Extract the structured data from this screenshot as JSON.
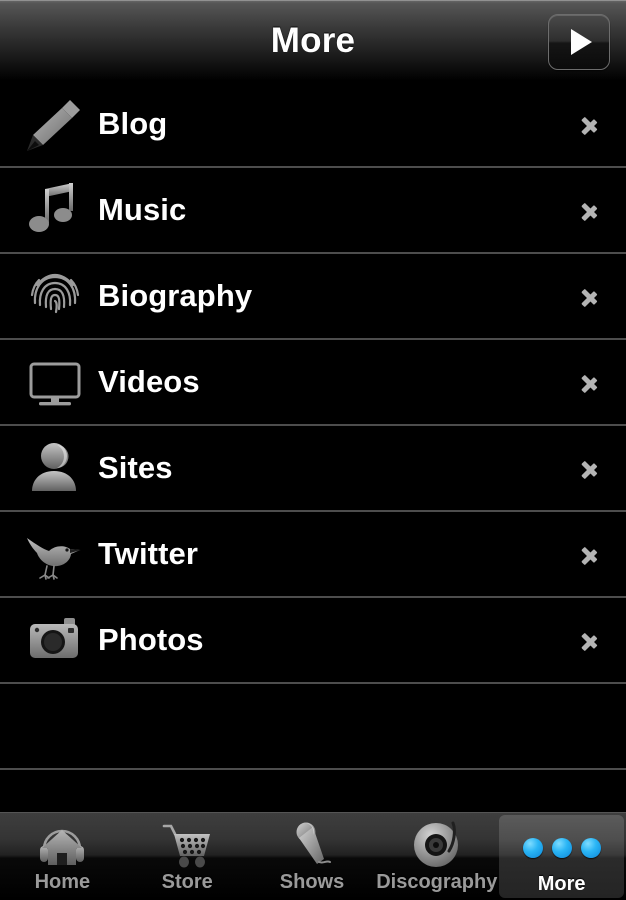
{
  "header": {
    "title": "More",
    "play_button_icon": "play-icon"
  },
  "list": {
    "rows": [
      {
        "label": "Blog",
        "icon": "pencil-icon",
        "accessory": "chevron-right-icon"
      },
      {
        "label": "Music",
        "icon": "music-note-icon",
        "accessory": "chevron-right-icon"
      },
      {
        "label": "Biography",
        "icon": "fingerprint-icon",
        "accessory": "chevron-right-icon"
      },
      {
        "label": "Videos",
        "icon": "monitor-icon",
        "accessory": "chevron-right-icon"
      },
      {
        "label": "Sites",
        "icon": "person-icon",
        "accessory": "chevron-right-icon"
      },
      {
        "label": "Twitter",
        "icon": "bird-icon",
        "accessory": "chevron-right-icon"
      },
      {
        "label": "Photos",
        "icon": "camera-icon",
        "accessory": "chevron-right-icon"
      },
      {
        "label": "",
        "icon": "",
        "accessory": ""
      }
    ]
  },
  "tabbar": {
    "tabs": [
      {
        "label": "Home",
        "icon": "house-headphones-icon",
        "selected": false
      },
      {
        "label": "Store",
        "icon": "shopping-cart-icon",
        "selected": false
      },
      {
        "label": "Shows",
        "icon": "microphone-icon",
        "selected": false
      },
      {
        "label": "Discography",
        "icon": "vinyl-record-icon",
        "selected": false
      },
      {
        "label": "More",
        "icon": "three-dots-icon",
        "selected": true
      }
    ]
  },
  "colors": {
    "background": "#000000",
    "text": "#ffffff",
    "tab_label": "#9a9a9a",
    "accent_blue": "#2ab5f5",
    "divider": "#4d4d4d",
    "icon_gray": "#8a8a8a"
  }
}
